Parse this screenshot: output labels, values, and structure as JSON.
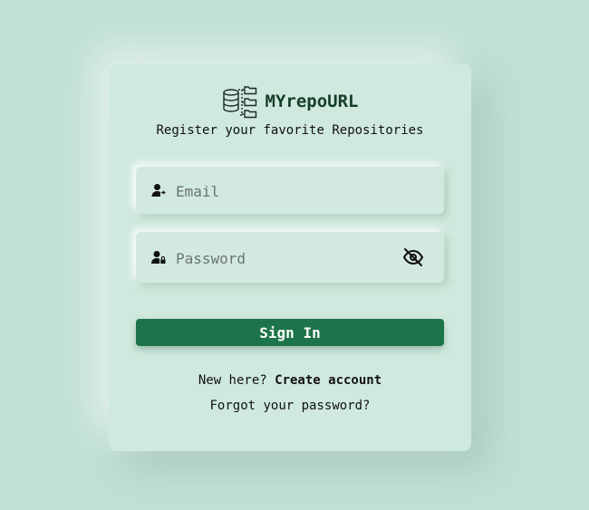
{
  "app": {
    "name": "MYrepoURL",
    "tagline": "Register your favorite Repositories"
  },
  "form": {
    "email_placeholder": "Email",
    "email_value": "",
    "password_placeholder": "Password",
    "password_value": "",
    "signin_label": "Sign In"
  },
  "footer": {
    "new_here": "New here?",
    "create_account": "Create account",
    "forgot": "Forgot your password?"
  },
  "icons": {
    "logo": "database-folders-icon",
    "email": "user-arrow-icon",
    "password": "user-lock-icon",
    "toggle": "eye-off-icon"
  },
  "colors": {
    "background": "#c0e0d4",
    "card": "#d0e9de",
    "brand": "#16402c",
    "button": "#1e744a"
  }
}
